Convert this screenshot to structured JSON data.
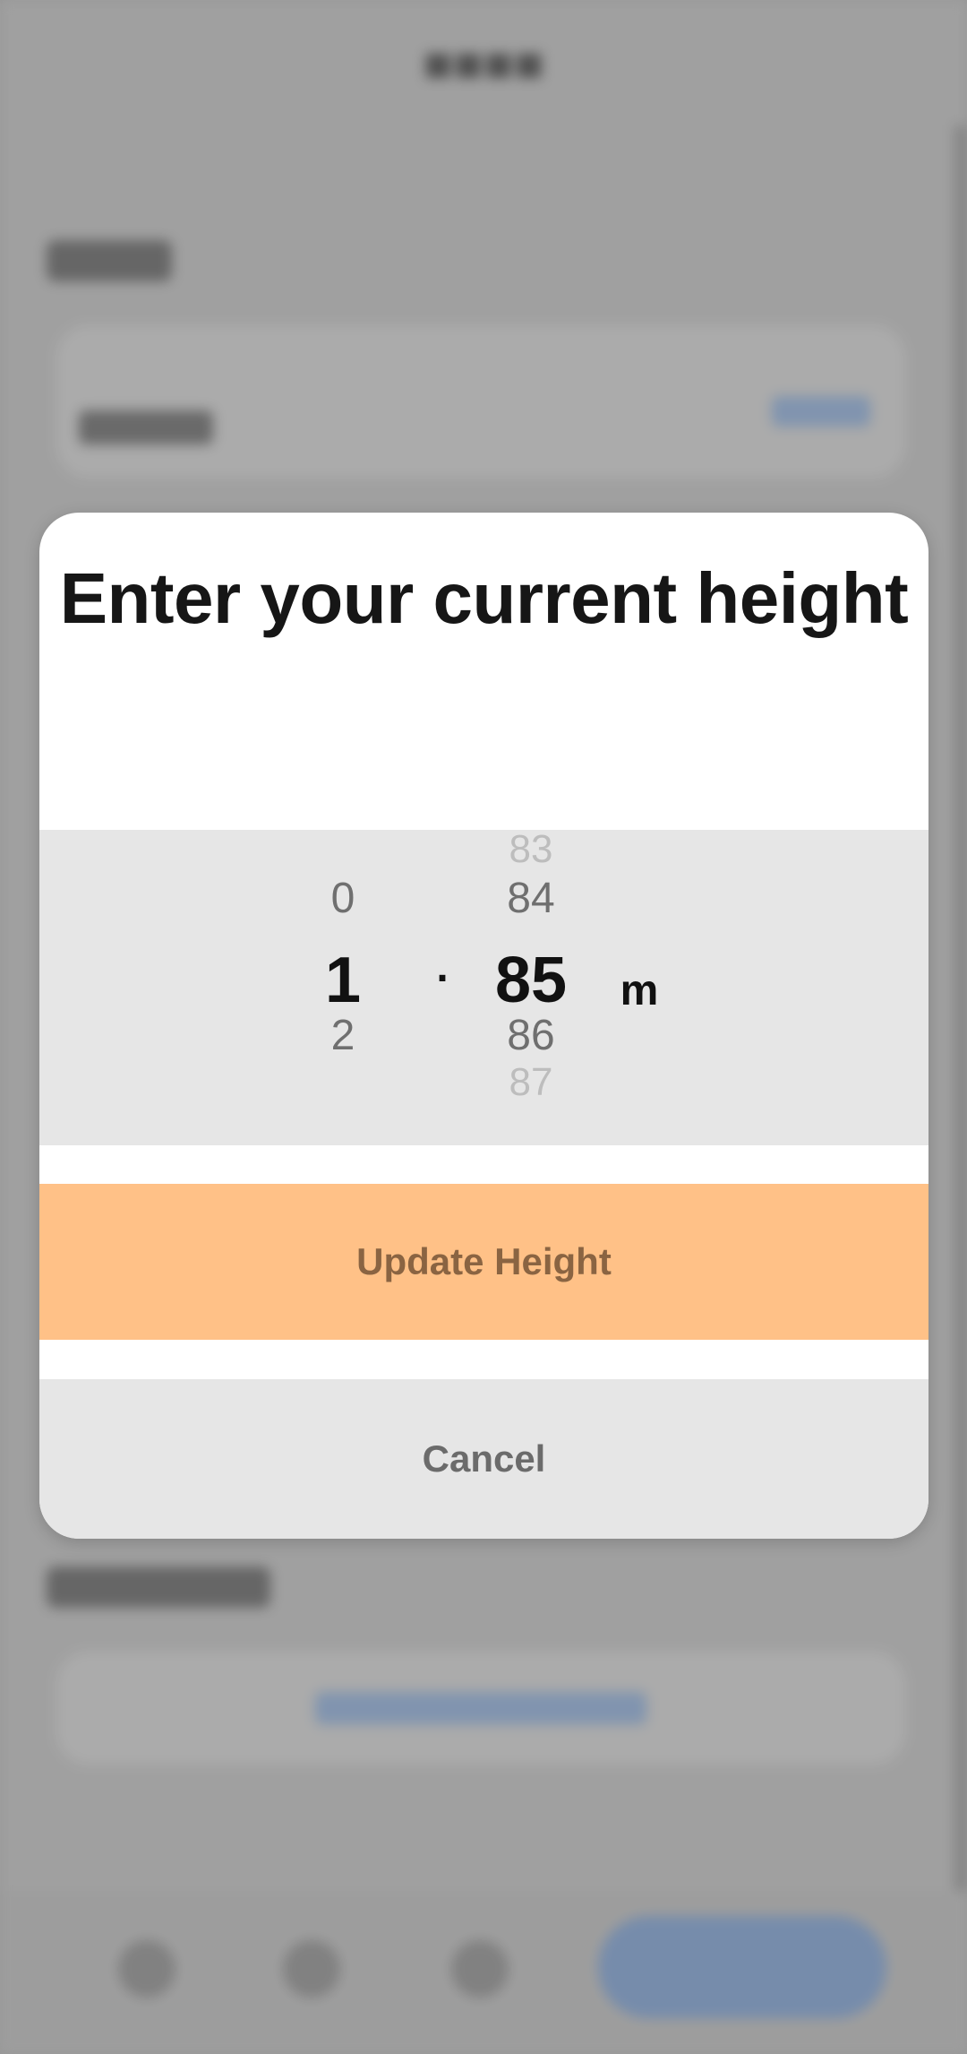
{
  "dialog": {
    "title": "Enter your current height",
    "picker": {
      "integer": {
        "above": "0",
        "selected": "1",
        "below": "2"
      },
      "separator": ".",
      "decimal": {
        "above_far": "83",
        "above": "84",
        "selected": "85",
        "below": "86",
        "below_far": "87"
      },
      "unit": "m"
    },
    "update_label": "Update Height",
    "cancel_label": "Cancel"
  },
  "colors": {
    "primary_button_bg": "#ffc187",
    "primary_button_text": "#8a6442",
    "secondary_button_bg": "#e6e6e6",
    "secondary_button_text": "#6b6b6b",
    "picker_bg": "#e6e6e6"
  }
}
